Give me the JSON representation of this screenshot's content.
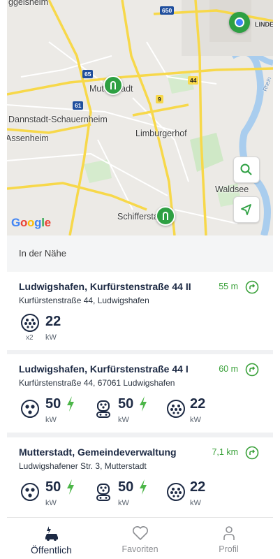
{
  "map": {
    "labels": {
      "oggersheim_partial": "ggeisheim",
      "mutterstadt": "Mutterstadt",
      "dannstadt": "Dannstadt-Schauernheim",
      "assenheim": "Assenheim",
      "limburgerhof": "Limburgerhof",
      "waldsee": "Waldsee",
      "schifferstadt": "Schifferstadt",
      "linden_partial": "LINDE",
      "rhein_partial": "Rhein"
    },
    "roads": {
      "r650": "650",
      "r65": "65",
      "r61": "61",
      "r44": "44",
      "r9": "9"
    },
    "google_logo": "Google",
    "icons": {
      "search": "search-icon",
      "locate": "navigation-arrow-icon",
      "station_pin": "charging-station-icon"
    }
  },
  "list": {
    "section_title": "In der Nähe",
    "stations": [
      {
        "title": "Ludwigshafen, Kurfürstenstraße 44 II",
        "address": "Kurfürstenstraße 44, Ludwigshafen",
        "distance": "55 m",
        "connectors": [
          {
            "icon": "type2-plug-icon",
            "power": "22",
            "unit": "kW",
            "multiplier": "x2",
            "fast": false
          }
        ]
      },
      {
        "title": "Ludwigshafen, Kurfürstenstraße 44 I",
        "address": "Kurfürstenstraße 44, 67061 Ludwigshafen",
        "distance": "60 m",
        "connectors": [
          {
            "icon": "ccs-plug-icon",
            "power": "50",
            "unit": "kW",
            "fast": true
          },
          {
            "icon": "chademo-plug-icon",
            "power": "50",
            "unit": "kW",
            "fast": true
          },
          {
            "icon": "type2-plug-icon",
            "power": "22",
            "unit": "kW",
            "fast": false
          }
        ]
      },
      {
        "title": "Mutterstadt, Gemeindeverwaltung",
        "address": "Ludwigshafener Str. 3, Mutterstadt",
        "distance": "7,1 km",
        "connectors": [
          {
            "icon": "ccs-plug-icon",
            "power": "50",
            "unit": "kW",
            "fast": true
          },
          {
            "icon": "chademo-plug-icon",
            "power": "50",
            "unit": "kW",
            "fast": true
          },
          {
            "icon": "type2-plug-icon",
            "power": "22",
            "unit": "kW",
            "fast": false
          }
        ]
      }
    ]
  },
  "bottom_nav": {
    "tabs": [
      {
        "label": "Öffentlich",
        "icon": "charging-car-icon",
        "active": true
      },
      {
        "label": "Favoriten",
        "icon": "heart-icon",
        "active": false
      },
      {
        "label": "Profil",
        "icon": "person-icon",
        "active": false
      }
    ]
  },
  "colors": {
    "accent_green": "#2ea043",
    "distance_green": "#3aa13a",
    "title_navy": "#1d2a44",
    "user_dot_blue": "#3b82f6"
  }
}
